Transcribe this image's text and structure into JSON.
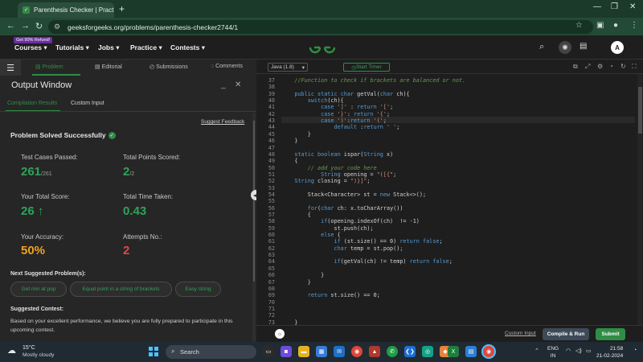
{
  "browser": {
    "tab_title": "Parenthesis Checker | Practice |",
    "tab_favicon": "GFG",
    "url": "geeksforgeeks.org/problems/parenthesis-checker2744/1"
  },
  "site_header": {
    "promo_badge": "Get 90% Refund!",
    "nav": [
      "Courses",
      "Tutorials",
      "Jobs",
      "Practice",
      "Contests"
    ],
    "avatar_letter": "A"
  },
  "problem_tabs": [
    "Problem",
    "Editorial",
    "Submissions",
    "Comments"
  ],
  "output_window": {
    "title": "Output Window",
    "tabs": [
      "Compilation Results",
      "Custom Input"
    ],
    "suggest_feedback": "Suggest Feedback",
    "status": "Problem Solved Successfully",
    "stats": {
      "test_cases_label": "Test Cases Passed:",
      "test_cases_value": "261",
      "test_cases_total": "/261",
      "points_label": "Total Points Scored:",
      "points_value": "2",
      "points_total": "/2",
      "score_label": "Your Total Score:",
      "score_value": "26",
      "time_label": "Total Time Taken:",
      "time_value": "0.43",
      "accuracy_label": "Your Accuracy:",
      "accuracy_value": "50%",
      "attempts_label": "Attempts No.:",
      "attempts_value": "2"
    },
    "suggested_label": "Next Suggested Problem(s):",
    "suggested": [
      "Get min at pop",
      "Equal point in a string of brackets",
      "Easy string"
    ],
    "contest_label": "Suggested Contest:",
    "contest_text": "Based on your excellent performance, we believe you are fully prepared to participate in this upcoming contest."
  },
  "editor": {
    "language": "Java (1.8)",
    "start_timer": "Start Timer",
    "lines": [
      {
        "n": "37",
        "code": "    //Function to check if brackets are balanced or not."
      },
      {
        "n": "38",
        "code": ""
      },
      {
        "n": "39",
        "code": "    public static char getVal(char ch){"
      },
      {
        "n": "40",
        "code": "        switch(ch){"
      },
      {
        "n": "41",
        "code": "            case ']' : return '[';"
      },
      {
        "n": "42",
        "code": "            case '}': return '{';"
      },
      {
        "n": "43",
        "code": "            case ')':return '(';"
      },
      {
        "n": "44",
        "code": "                default :return ' ';"
      },
      {
        "n": "45",
        "code": "        }"
      },
      {
        "n": "46",
        "code": "    }"
      },
      {
        "n": "47",
        "code": ""
      },
      {
        "n": "48",
        "code": "    static boolean ispar(String x)"
      },
      {
        "n": "49",
        "code": "    {"
      },
      {
        "n": "50",
        "code": "        // add your code here"
      },
      {
        "n": "51",
        "code": "            String opening = \"([{\";"
      },
      {
        "n": "52",
        "code": "    String closing = \")}]\";"
      },
      {
        "n": "53",
        "code": ""
      },
      {
        "n": "54",
        "code": "        Stack<Character> st = new Stack<>();"
      },
      {
        "n": "55",
        "code": ""
      },
      {
        "n": "56",
        "code": "        for(char ch: x.toCharArray())"
      },
      {
        "n": "57",
        "code": "        {"
      },
      {
        "n": "58",
        "code": "            if(opening.indexOf(ch)  != -1)"
      },
      {
        "n": "59",
        "code": "                st.push(ch);"
      },
      {
        "n": "60",
        "code": "            else {"
      },
      {
        "n": "61",
        "code": "                if (st.size() == 0) return false;"
      },
      {
        "n": "62",
        "code": "                char temp = st.pop();"
      },
      {
        "n": "63",
        "code": ""
      },
      {
        "n": "64",
        "code": "                if(getVal(ch) != temp) return false;"
      },
      {
        "n": "65",
        "code": ""
      },
      {
        "n": "66",
        "code": "            }"
      },
      {
        "n": "67",
        "code": "        }"
      },
      {
        "n": "68",
        "code": ""
      },
      {
        "n": "69",
        "code": "        return st.size() == 0;"
      },
      {
        "n": "70",
        "code": ""
      },
      {
        "n": "71",
        "code": ""
      },
      {
        "n": "72",
        "code": ""
      },
      {
        "n": "73",
        "code": "    }"
      }
    ],
    "custom_input": "Custom Input",
    "compile_run": "Compile & Run",
    "submit": "Submit"
  },
  "taskbar": {
    "temp": "15°C",
    "weather": "Mostly cloudy",
    "search": "Search",
    "lang": "ENG",
    "region": "IN",
    "time": "21:58",
    "date": "21-02-2024"
  },
  "colors": {
    "accent": "#2f8d46",
    "orange": "#f0a21c",
    "red": "#e04848"
  }
}
